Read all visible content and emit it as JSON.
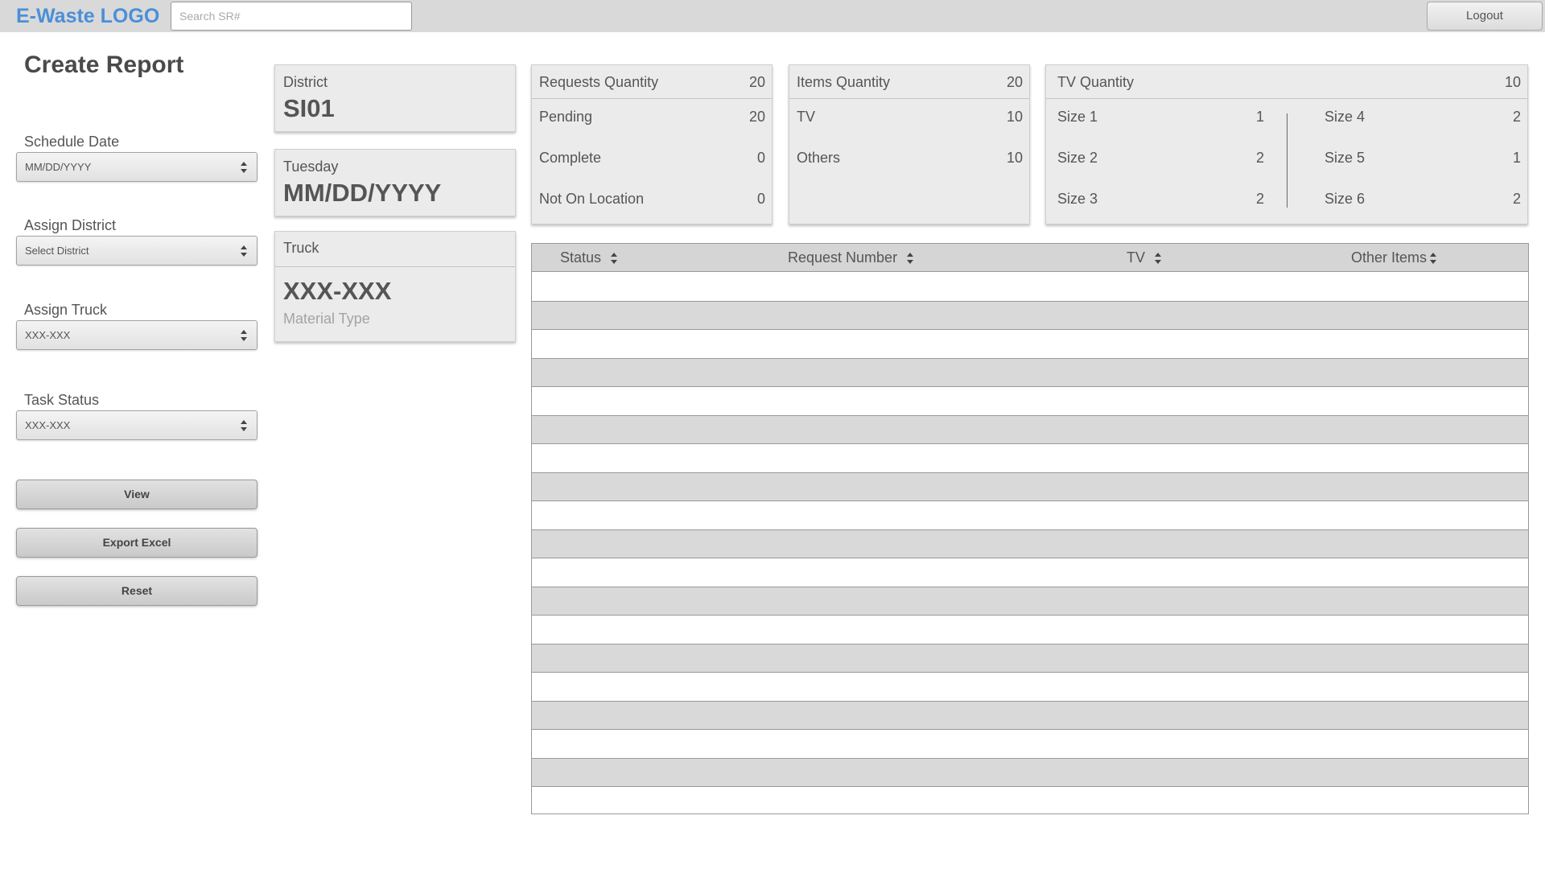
{
  "header": {
    "logo": "E-Waste LOGO",
    "search_placeholder": "Search SR#",
    "logout_label": "Logout"
  },
  "sidebar": {
    "title": "Create Report",
    "schedule_date": {
      "label": "Schedule Date",
      "value": "MM/DD/YYYY"
    },
    "assign_district": {
      "label": "Assign District",
      "value": "Select District"
    },
    "assign_truck": {
      "label": "Assign Truck",
      "value": "XXX-XXX"
    },
    "task_status": {
      "label": "Task Status",
      "value": "XXX-XXX"
    },
    "buttons": {
      "view": "View",
      "export": "Export Excel",
      "reset": "Reset"
    }
  },
  "info_cards": {
    "district": {
      "label": "District",
      "value": "SI01"
    },
    "date": {
      "label": "Tuesday",
      "value": "MM/DD/YYYY"
    },
    "truck": {
      "label": "Truck",
      "value": "XXX-XXX",
      "material_label": "Material Type"
    }
  },
  "requests": {
    "title": "Requests Quantity",
    "total": "20",
    "rows": [
      {
        "label": "Pending",
        "value": "20"
      },
      {
        "label": "Complete",
        "value": "0"
      },
      {
        "label": "Not On Location",
        "value": "0"
      }
    ]
  },
  "items": {
    "title": "Items Quantity",
    "total": "20",
    "rows": [
      {
        "label": "TV",
        "value": "10"
      },
      {
        "label": "Others",
        "value": "10"
      }
    ]
  },
  "tv": {
    "title": "TV Quantity",
    "total": "10",
    "left": [
      {
        "label": "Size 1",
        "value": "1"
      },
      {
        "label": "Size 2",
        "value": "2"
      },
      {
        "label": "Size 3",
        "value": "2"
      }
    ],
    "right": [
      {
        "label": "Size 4",
        "value": "2"
      },
      {
        "label": "Size 5",
        "value": "1"
      },
      {
        "label": "Size 6",
        "value": "2"
      }
    ]
  },
  "table": {
    "columns": [
      "Status",
      "Request Number",
      "TV",
      "Other Items"
    ],
    "rows": []
  },
  "colors": {
    "logo": "#4a8fd8",
    "header_bg": "#d9d9d9",
    "card_bg": "#ebebeb",
    "row_shade": "#d9d9d9"
  }
}
